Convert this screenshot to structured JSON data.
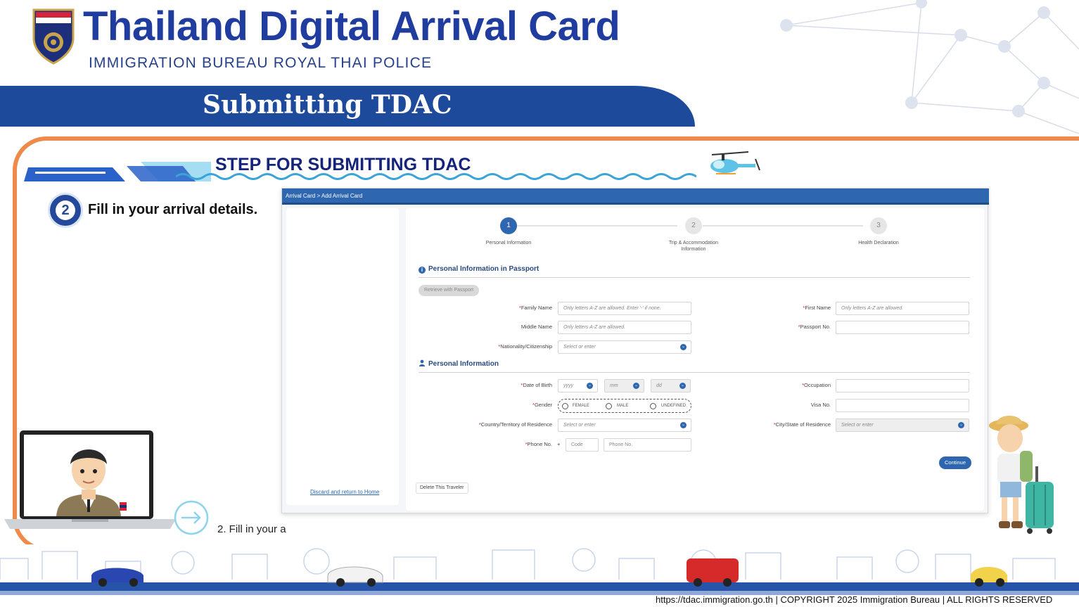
{
  "header": {
    "title": "Thailand Digital Arrival Card",
    "subtitle": "IMMIGRATION BUREAU ROYAL THAI POLICE",
    "banner": "Submitting TDAC",
    "emblem_text": "ROYAL THAI POLICE IMMIGRATION BUREAU"
  },
  "step": {
    "heading": "STEP FOR SUBMITTING TDAC",
    "number": "2",
    "label": "Fill in your arrival details.",
    "caption": "2. Fill in your a"
  },
  "form": {
    "breadcrumb": "Arrival Card > Add Arrival Card",
    "discard_link": "Discard and return to Home",
    "steps": [
      {
        "number": "1",
        "label": "Personal Information"
      },
      {
        "number": "2",
        "label": "Trip & Accommodation Information"
      },
      {
        "number": "3",
        "label": "Health Declaration"
      }
    ],
    "section_passport": "Personal Information in Passport",
    "retrieve_button": "Retrieve with Passport",
    "fields": {
      "family_name": {
        "label": "Family Name",
        "placeholder": "Only letters A-Z are allowed. Enter '-' if none."
      },
      "first_name": {
        "label": "First Name",
        "placeholder": "Only letters A-Z are allowed."
      },
      "middle_name": {
        "label": "Middle Name",
        "placeholder": "Only letters A-Z are allowed."
      },
      "passport_no": {
        "label": "Passport No.",
        "placeholder": ""
      },
      "nationality": {
        "label": "Nationality/Citizenship",
        "placeholder": "Select or enter"
      },
      "dob": {
        "label": "Date of Birth",
        "year": "yyyy",
        "month": "mm",
        "day": "dd"
      },
      "occupation": {
        "label": "Occupation",
        "placeholder": ""
      },
      "gender": {
        "label": "Gender",
        "options": [
          "FEMALE",
          "MALE",
          "UNDEFINED"
        ]
      },
      "visa_no": {
        "label": "Visa No.",
        "placeholder": ""
      },
      "country": {
        "label": "Country/Territory of Residence",
        "placeholder": "Select or enter"
      },
      "city": {
        "label": "City/State of Residence",
        "placeholder": "Select or enter"
      },
      "phone": {
        "label": "Phone No.",
        "plus": "+",
        "code": "Code",
        "number": "Phone No."
      }
    },
    "section_personal": "Personal Information",
    "continue_button": "Continue",
    "delete_button": "Delete This Traveler"
  },
  "footer": {
    "text": "https://tdac.immigration.go.th | COPYRIGHT 2025 Immigration Bureau | ALL RIGHTS RESERVED"
  },
  "colors": {
    "brand_blue": "#1f3c9e",
    "banner_blue": "#1e4a9c",
    "accent_orange": "#f08a4b",
    "form_blue": "#2e67b0"
  }
}
